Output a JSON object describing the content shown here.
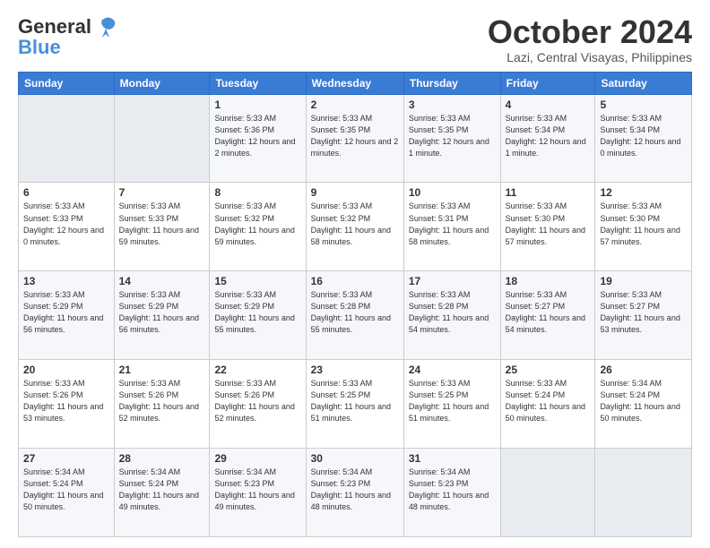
{
  "logo": {
    "line1": "General",
    "line2": "Blue"
  },
  "title": "October 2024",
  "location": "Lazi, Central Visayas, Philippines",
  "days_of_week": [
    "Sunday",
    "Monday",
    "Tuesday",
    "Wednesday",
    "Thursday",
    "Friday",
    "Saturday"
  ],
  "weeks": [
    [
      {
        "num": "",
        "sunrise": "",
        "sunset": "",
        "daylight": ""
      },
      {
        "num": "",
        "sunrise": "",
        "sunset": "",
        "daylight": ""
      },
      {
        "num": "1",
        "sunrise": "Sunrise: 5:33 AM",
        "sunset": "Sunset: 5:36 PM",
        "daylight": "Daylight: 12 hours and 2 minutes."
      },
      {
        "num": "2",
        "sunrise": "Sunrise: 5:33 AM",
        "sunset": "Sunset: 5:35 PM",
        "daylight": "Daylight: 12 hours and 2 minutes."
      },
      {
        "num": "3",
        "sunrise": "Sunrise: 5:33 AM",
        "sunset": "Sunset: 5:35 PM",
        "daylight": "Daylight: 12 hours and 1 minute."
      },
      {
        "num": "4",
        "sunrise": "Sunrise: 5:33 AM",
        "sunset": "Sunset: 5:34 PM",
        "daylight": "Daylight: 12 hours and 1 minute."
      },
      {
        "num": "5",
        "sunrise": "Sunrise: 5:33 AM",
        "sunset": "Sunset: 5:34 PM",
        "daylight": "Daylight: 12 hours and 0 minutes."
      }
    ],
    [
      {
        "num": "6",
        "sunrise": "Sunrise: 5:33 AM",
        "sunset": "Sunset: 5:33 PM",
        "daylight": "Daylight: 12 hours and 0 minutes."
      },
      {
        "num": "7",
        "sunrise": "Sunrise: 5:33 AM",
        "sunset": "Sunset: 5:33 PM",
        "daylight": "Daylight: 11 hours and 59 minutes."
      },
      {
        "num": "8",
        "sunrise": "Sunrise: 5:33 AM",
        "sunset": "Sunset: 5:32 PM",
        "daylight": "Daylight: 11 hours and 59 minutes."
      },
      {
        "num": "9",
        "sunrise": "Sunrise: 5:33 AM",
        "sunset": "Sunset: 5:32 PM",
        "daylight": "Daylight: 11 hours and 58 minutes."
      },
      {
        "num": "10",
        "sunrise": "Sunrise: 5:33 AM",
        "sunset": "Sunset: 5:31 PM",
        "daylight": "Daylight: 11 hours and 58 minutes."
      },
      {
        "num": "11",
        "sunrise": "Sunrise: 5:33 AM",
        "sunset": "Sunset: 5:30 PM",
        "daylight": "Daylight: 11 hours and 57 minutes."
      },
      {
        "num": "12",
        "sunrise": "Sunrise: 5:33 AM",
        "sunset": "Sunset: 5:30 PM",
        "daylight": "Daylight: 11 hours and 57 minutes."
      }
    ],
    [
      {
        "num": "13",
        "sunrise": "Sunrise: 5:33 AM",
        "sunset": "Sunset: 5:29 PM",
        "daylight": "Daylight: 11 hours and 56 minutes."
      },
      {
        "num": "14",
        "sunrise": "Sunrise: 5:33 AM",
        "sunset": "Sunset: 5:29 PM",
        "daylight": "Daylight: 11 hours and 56 minutes."
      },
      {
        "num": "15",
        "sunrise": "Sunrise: 5:33 AM",
        "sunset": "Sunset: 5:29 PM",
        "daylight": "Daylight: 11 hours and 55 minutes."
      },
      {
        "num": "16",
        "sunrise": "Sunrise: 5:33 AM",
        "sunset": "Sunset: 5:28 PM",
        "daylight": "Daylight: 11 hours and 55 minutes."
      },
      {
        "num": "17",
        "sunrise": "Sunrise: 5:33 AM",
        "sunset": "Sunset: 5:28 PM",
        "daylight": "Daylight: 11 hours and 54 minutes."
      },
      {
        "num": "18",
        "sunrise": "Sunrise: 5:33 AM",
        "sunset": "Sunset: 5:27 PM",
        "daylight": "Daylight: 11 hours and 54 minutes."
      },
      {
        "num": "19",
        "sunrise": "Sunrise: 5:33 AM",
        "sunset": "Sunset: 5:27 PM",
        "daylight": "Daylight: 11 hours and 53 minutes."
      }
    ],
    [
      {
        "num": "20",
        "sunrise": "Sunrise: 5:33 AM",
        "sunset": "Sunset: 5:26 PM",
        "daylight": "Daylight: 11 hours and 53 minutes."
      },
      {
        "num": "21",
        "sunrise": "Sunrise: 5:33 AM",
        "sunset": "Sunset: 5:26 PM",
        "daylight": "Daylight: 11 hours and 52 minutes."
      },
      {
        "num": "22",
        "sunrise": "Sunrise: 5:33 AM",
        "sunset": "Sunset: 5:26 PM",
        "daylight": "Daylight: 11 hours and 52 minutes."
      },
      {
        "num": "23",
        "sunrise": "Sunrise: 5:33 AM",
        "sunset": "Sunset: 5:25 PM",
        "daylight": "Daylight: 11 hours and 51 minutes."
      },
      {
        "num": "24",
        "sunrise": "Sunrise: 5:33 AM",
        "sunset": "Sunset: 5:25 PM",
        "daylight": "Daylight: 11 hours and 51 minutes."
      },
      {
        "num": "25",
        "sunrise": "Sunrise: 5:33 AM",
        "sunset": "Sunset: 5:24 PM",
        "daylight": "Daylight: 11 hours and 50 minutes."
      },
      {
        "num": "26",
        "sunrise": "Sunrise: 5:34 AM",
        "sunset": "Sunset: 5:24 PM",
        "daylight": "Daylight: 11 hours and 50 minutes."
      }
    ],
    [
      {
        "num": "27",
        "sunrise": "Sunrise: 5:34 AM",
        "sunset": "Sunset: 5:24 PM",
        "daylight": "Daylight: 11 hours and 50 minutes."
      },
      {
        "num": "28",
        "sunrise": "Sunrise: 5:34 AM",
        "sunset": "Sunset: 5:24 PM",
        "daylight": "Daylight: 11 hours and 49 minutes."
      },
      {
        "num": "29",
        "sunrise": "Sunrise: 5:34 AM",
        "sunset": "Sunset: 5:23 PM",
        "daylight": "Daylight: 11 hours and 49 minutes."
      },
      {
        "num": "30",
        "sunrise": "Sunrise: 5:34 AM",
        "sunset": "Sunset: 5:23 PM",
        "daylight": "Daylight: 11 hours and 48 minutes."
      },
      {
        "num": "31",
        "sunrise": "Sunrise: 5:34 AM",
        "sunset": "Sunset: 5:23 PM",
        "daylight": "Daylight: 11 hours and 48 minutes."
      },
      {
        "num": "",
        "sunrise": "",
        "sunset": "",
        "daylight": ""
      },
      {
        "num": "",
        "sunrise": "",
        "sunset": "",
        "daylight": ""
      }
    ]
  ]
}
